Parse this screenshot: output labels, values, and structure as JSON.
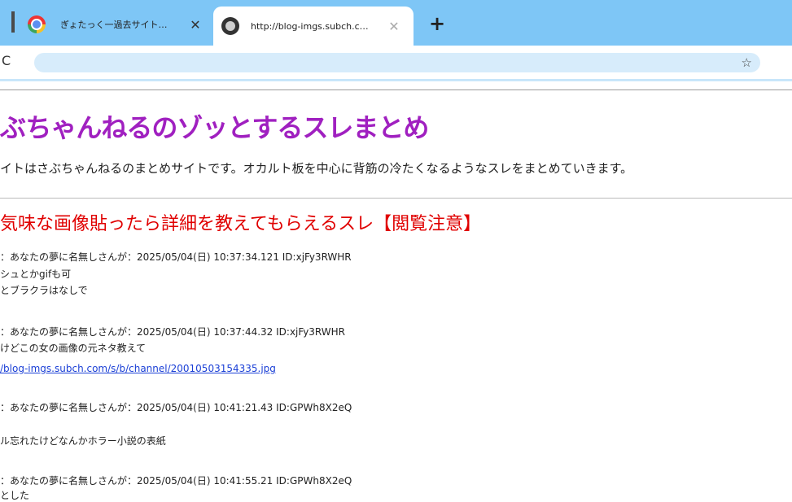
{
  "browser": {
    "tabs": [
      {
        "title": "ぎょたっく一過去サイト…",
        "close": "✕",
        "icon": "tab-favicon-icon"
      },
      {
        "title": "http://blog-imgs.subch.c…",
        "close": "✕",
        "icon": "github-icon"
      }
    ],
    "new_tab": "+",
    "reload": "C",
    "star": "☆",
    "address_value": ""
  },
  "page": {
    "site_title": "ぶちゃんねるのゾッとするスレまとめ",
    "site_desc": "イトはさぶちゃんねるのまとめサイトです。オカルト板を中心に背筋の冷たくなるようなスレをまとめていきます。",
    "thread_title": "気味な画像貼ったら詳細を教えてもらえるスレ【閲覧注意】",
    "posts": [
      {
        "header": "：あなたの夢に名無しさんが：2025/05/04(日) 10:37:34.121 ID:xjFy3RWHR",
        "lines": [
          "シュとかgifも可",
          "とブラクラはなしで"
        ]
      },
      {
        "header": "：あなたの夢に名無しさんが：2025/05/04(日) 10:37:44.32 ID:xjFy3RWHR",
        "lines": [
          "けどこの女の画像の元ネタ教えて"
        ],
        "link": "/blog-imgs.subch.com/s/b/channel/20010503154335.jpg"
      },
      {
        "header": "：あなたの夢に名無しさんが：2025/05/04(日) 10:41:21.43 ID:GPWh8X2eQ",
        "lines": [
          "ル忘れたけどなんかホラー小説の表紙"
        ]
      },
      {
        "header": "：あなたの夢に名無しさんが：2025/05/04(日) 10:41:55.21 ID:GPWh8X2eQ",
        "lines": [
          "とした"
        ]
      }
    ]
  }
}
